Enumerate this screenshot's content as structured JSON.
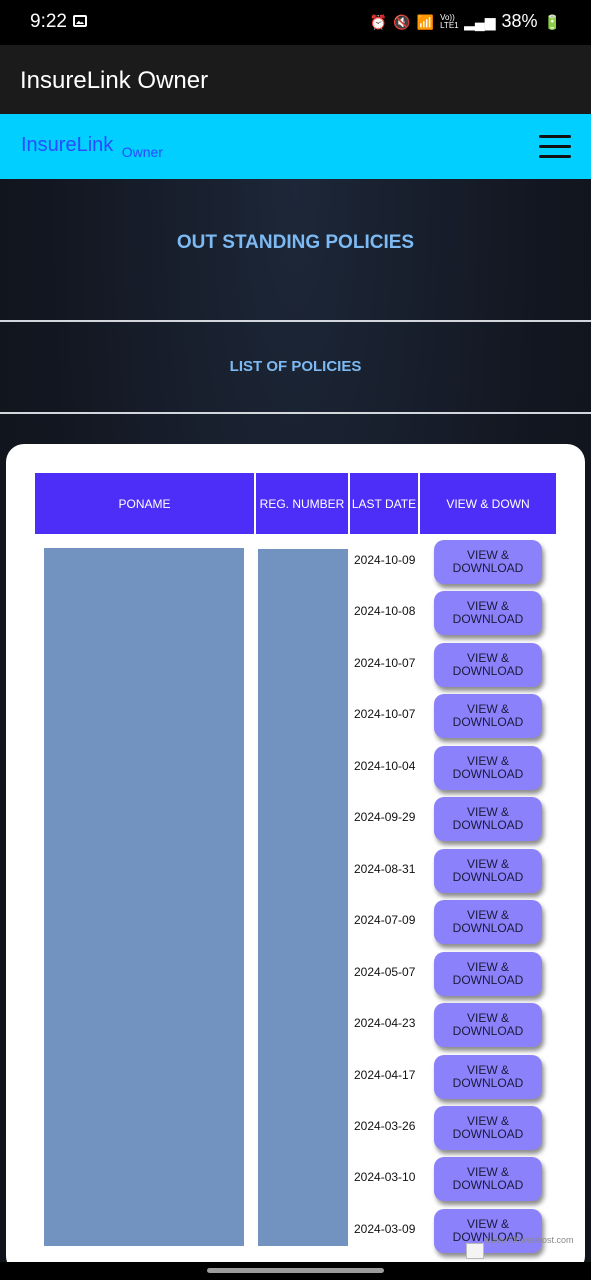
{
  "status_bar": {
    "time": "9:22",
    "icons": [
      "image-icon",
      "alarm-icon",
      "mute-icon",
      "wifi-icon",
      "volte-icon",
      "signal-icon"
    ],
    "volte_text": "Vo)) LTE1",
    "battery": "38%"
  },
  "app_bar": {
    "title": "InsureLink Owner"
  },
  "nav": {
    "brand": "InsureLink",
    "brand_sub": "Owner",
    "menu_icon": "hamburger-icon"
  },
  "page": {
    "heading": "OUT STANDING POLICIES",
    "subheading": "LIST OF POLICIES"
  },
  "table": {
    "headers": [
      "PONAME",
      "REG. NUMBER",
      "LAST DATE",
      "VIEW & DOWN"
    ],
    "button_label": "VIEW &\nDOWNLOAD",
    "dates": [
      "2024-10-09",
      "2024-10-08",
      "2024-10-07",
      "2024-10-07",
      "2024-10-04",
      "2024-09-29",
      "2024-08-31",
      "2024-07-09",
      "2024-05-07",
      "2024-04-23",
      "2024-04-17",
      "2024-03-26",
      "2024-03-10",
      "2024-03-09"
    ]
  },
  "watermark": "www.000webhost.com",
  "colors": {
    "nav_bg": "#00cfff",
    "header_bg": "#4c2ef8",
    "button_bg": "#8b82fb",
    "heading_text": "#7db9f2",
    "redaction": "#7293bf"
  }
}
